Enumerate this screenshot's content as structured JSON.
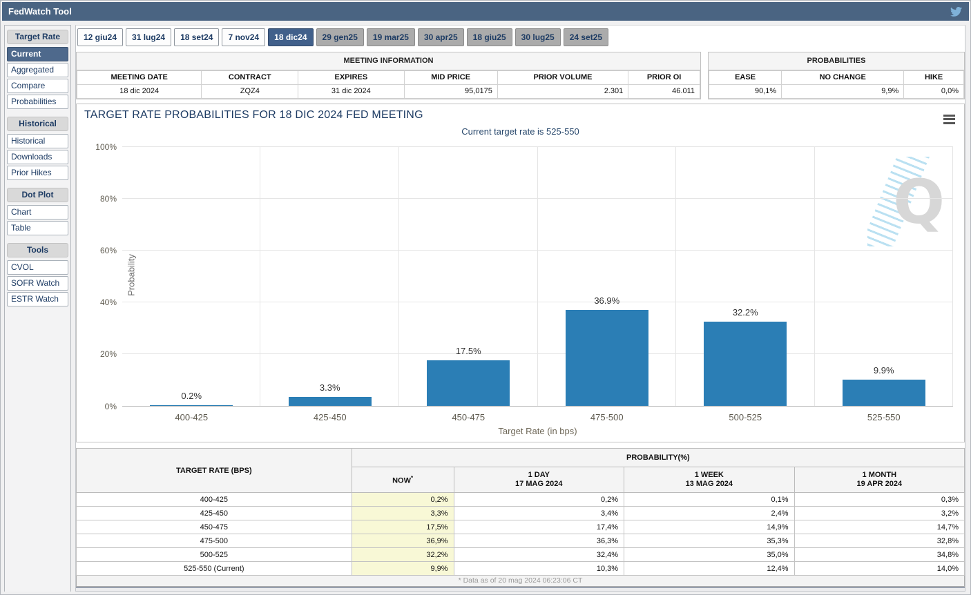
{
  "header": {
    "title": "FedWatch Tool",
    "twitter_icon": "twitter-bird"
  },
  "sidebar": {
    "sections": [
      {
        "label": "Target Rate",
        "items": [
          {
            "label": "Current",
            "selected": true
          },
          {
            "label": "Aggregated",
            "selected": false
          },
          {
            "label": "Compare",
            "selected": false
          },
          {
            "label": "Probabilities",
            "selected": false
          }
        ]
      },
      {
        "label": "Historical",
        "items": [
          {
            "label": "Historical",
            "selected": false
          },
          {
            "label": "Downloads",
            "selected": false
          },
          {
            "label": "Prior Hikes",
            "selected": false
          }
        ]
      },
      {
        "label": "Dot Plot",
        "items": [
          {
            "label": "Chart",
            "selected": false
          },
          {
            "label": "Table",
            "selected": false
          }
        ]
      },
      {
        "label": "Tools",
        "items": [
          {
            "label": "CVOL",
            "selected": false
          },
          {
            "label": "SOFR Watch",
            "selected": false
          },
          {
            "label": "ESTR Watch",
            "selected": false
          }
        ]
      }
    ]
  },
  "tabs": [
    {
      "label": "12 giu24",
      "state": "normal"
    },
    {
      "label": "31 lug24",
      "state": "normal"
    },
    {
      "label": "18 set24",
      "state": "normal"
    },
    {
      "label": "7 nov24",
      "state": "normal"
    },
    {
      "label": "18 dic24",
      "state": "selected"
    },
    {
      "label": "29 gen25",
      "state": "future"
    },
    {
      "label": "19 mar25",
      "state": "future"
    },
    {
      "label": "30 apr25",
      "state": "future"
    },
    {
      "label": "18 giu25",
      "state": "future"
    },
    {
      "label": "30 lug25",
      "state": "future"
    },
    {
      "label": "24 set25",
      "state": "future"
    }
  ],
  "meeting_information": {
    "title": "MEETING INFORMATION",
    "columns": [
      "MEETING DATE",
      "CONTRACT",
      "EXPIRES",
      "MID PRICE",
      "PRIOR VOLUME",
      "PRIOR OI"
    ],
    "values": [
      "18 dic 2024",
      "ZQZ4",
      "31 dic 2024",
      "95,0175",
      "2.301",
      "46.011"
    ],
    "aligns": [
      "c",
      "c",
      "c",
      "r",
      "r",
      "r"
    ],
    "widths": [
      20,
      15.5,
      17,
      15,
      21,
      11.5
    ]
  },
  "probabilities_summary": {
    "title": "PROBABILITIES",
    "columns": [
      "EASE",
      "NO CHANGE",
      "HIKE"
    ],
    "values": [
      "90,1%",
      "9,9%",
      "0,0%"
    ],
    "aligns": [
      "r",
      "r",
      "r"
    ],
    "widths": [
      28.5,
      48,
      23.5
    ]
  },
  "chart_data": {
    "type": "bar",
    "title": "TARGET RATE PROBABILITIES FOR 18 DIC 2024 FED MEETING",
    "subtitle": "Current target rate is 525-550",
    "categories": [
      "400-425",
      "425-450",
      "450-475",
      "475-500",
      "500-525",
      "525-550"
    ],
    "values": [
      0.2,
      3.3,
      17.5,
      36.9,
      32.2,
      9.9
    ],
    "bar_labels": [
      "0.2%",
      "3.3%",
      "17.5%",
      "36.9%",
      "32.2%",
      "9.9%"
    ],
    "xlabel": "Target Rate (in bps)",
    "ylabel": "Probability",
    "ylim": [
      0,
      100
    ],
    "yticks": [
      0,
      20,
      40,
      60,
      80,
      100
    ],
    "ytick_labels": [
      "0%",
      "20%",
      "40%",
      "60%",
      "80%",
      "100%"
    ],
    "grid": true,
    "legend": false,
    "bar_color": "#2b7eb5",
    "watermark": "Q"
  },
  "probability_table": {
    "header_left": "TARGET RATE (BPS)",
    "header_right": "PROBABILITY(%)",
    "columns": [
      {
        "label": "NOW",
        "sup": "*",
        "sub": ""
      },
      {
        "label": "1 DAY",
        "sub": "17 MAG 2024"
      },
      {
        "label": "1 WEEK",
        "sub": "13 MAG 2024"
      },
      {
        "label": "1 MONTH",
        "sub": "19 APR 2024"
      }
    ],
    "rows": [
      {
        "rate": "400-425",
        "values": [
          "0,2%",
          "0,2%",
          "0,1%",
          "0,3%"
        ]
      },
      {
        "rate": "425-450",
        "values": [
          "3,3%",
          "3,4%",
          "2,4%",
          "3,2%"
        ]
      },
      {
        "rate": "450-475",
        "values": [
          "17,5%",
          "17,4%",
          "14,9%",
          "14,7%"
        ]
      },
      {
        "rate": "475-500",
        "values": [
          "36,9%",
          "36,3%",
          "35,3%",
          "32,8%"
        ]
      },
      {
        "rate": "500-525",
        "values": [
          "32,2%",
          "32,4%",
          "35,0%",
          "34,8%"
        ]
      },
      {
        "rate": "525-550 (Current)",
        "values": [
          "9,9%",
          "10,3%",
          "12,4%",
          "14,0%"
        ]
      }
    ],
    "footnote": "* Data as of 20 mag 2024 06:23:06 CT"
  },
  "colors": {
    "titlebar": "#4a6482",
    "selected": "#41608b",
    "navy_text": "#1e3c64",
    "bar": "#2b7eb5",
    "now_column": "#f8f8d6",
    "tab_future": "#ababab"
  }
}
